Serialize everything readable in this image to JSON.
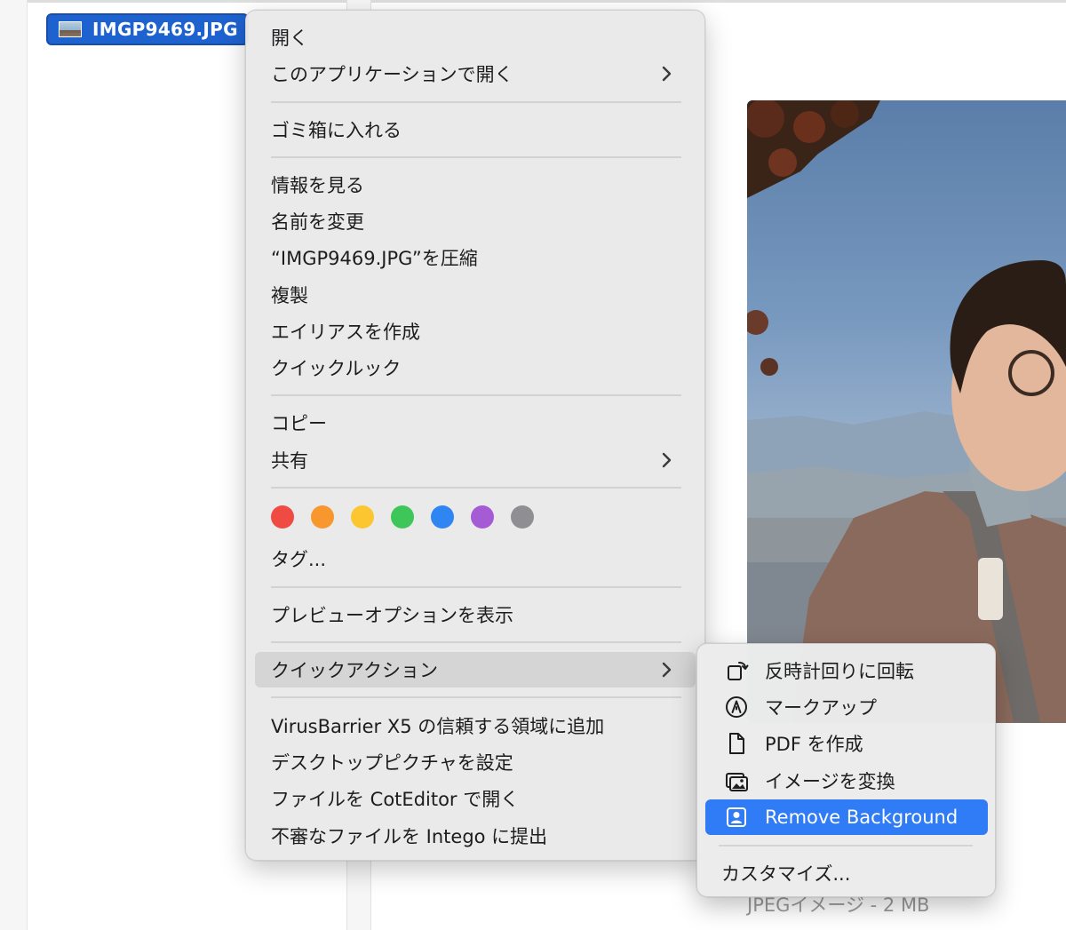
{
  "finder": {
    "selected_file_name": "IMGP9469.JPG",
    "preview_caption": "JPEGイメージ - 2 MB"
  },
  "context_menu": {
    "open": "開く",
    "open_with": "このアプリケーションで開く",
    "move_to_trash": "ゴミ箱に入れる",
    "get_info": "情報を見る",
    "rename": "名前を変更",
    "compress": "“IMGP9469.JPG”を圧縮",
    "duplicate": "複製",
    "make_alias": "エイリアスを作成",
    "quick_look": "クイックルック",
    "copy": "コピー",
    "share": "共有",
    "tag_colors": [
      "#f04b42",
      "#f7972d",
      "#fbc62f",
      "#3fc65b",
      "#2f86f2",
      "#a45bd3",
      "#8f8f93"
    ],
    "tags": "タグ...",
    "show_preview_options": "プレビューオプションを表示",
    "quick_actions": "クイックアクション",
    "virusbarrier": "VirusBarrier X5 の信頼する領域に追加",
    "set_desktop_picture": "デスクトップピクチャを設定",
    "open_in_coteditor": "ファイルを CotEditor で開く",
    "submit_to_intego": "不審なファイルを Intego に提出"
  },
  "quick_actions_submenu": {
    "rotate_left": "反時計回りに回転",
    "markup": "マークアップ",
    "create_pdf": "PDF を作成",
    "convert_image": "イメージを変換",
    "remove_background": "Remove Background",
    "customize": "カスタマイズ..."
  },
  "colors": {
    "selection_blue": "#1e62d0",
    "highlight_blue": "#2f7cf6"
  }
}
